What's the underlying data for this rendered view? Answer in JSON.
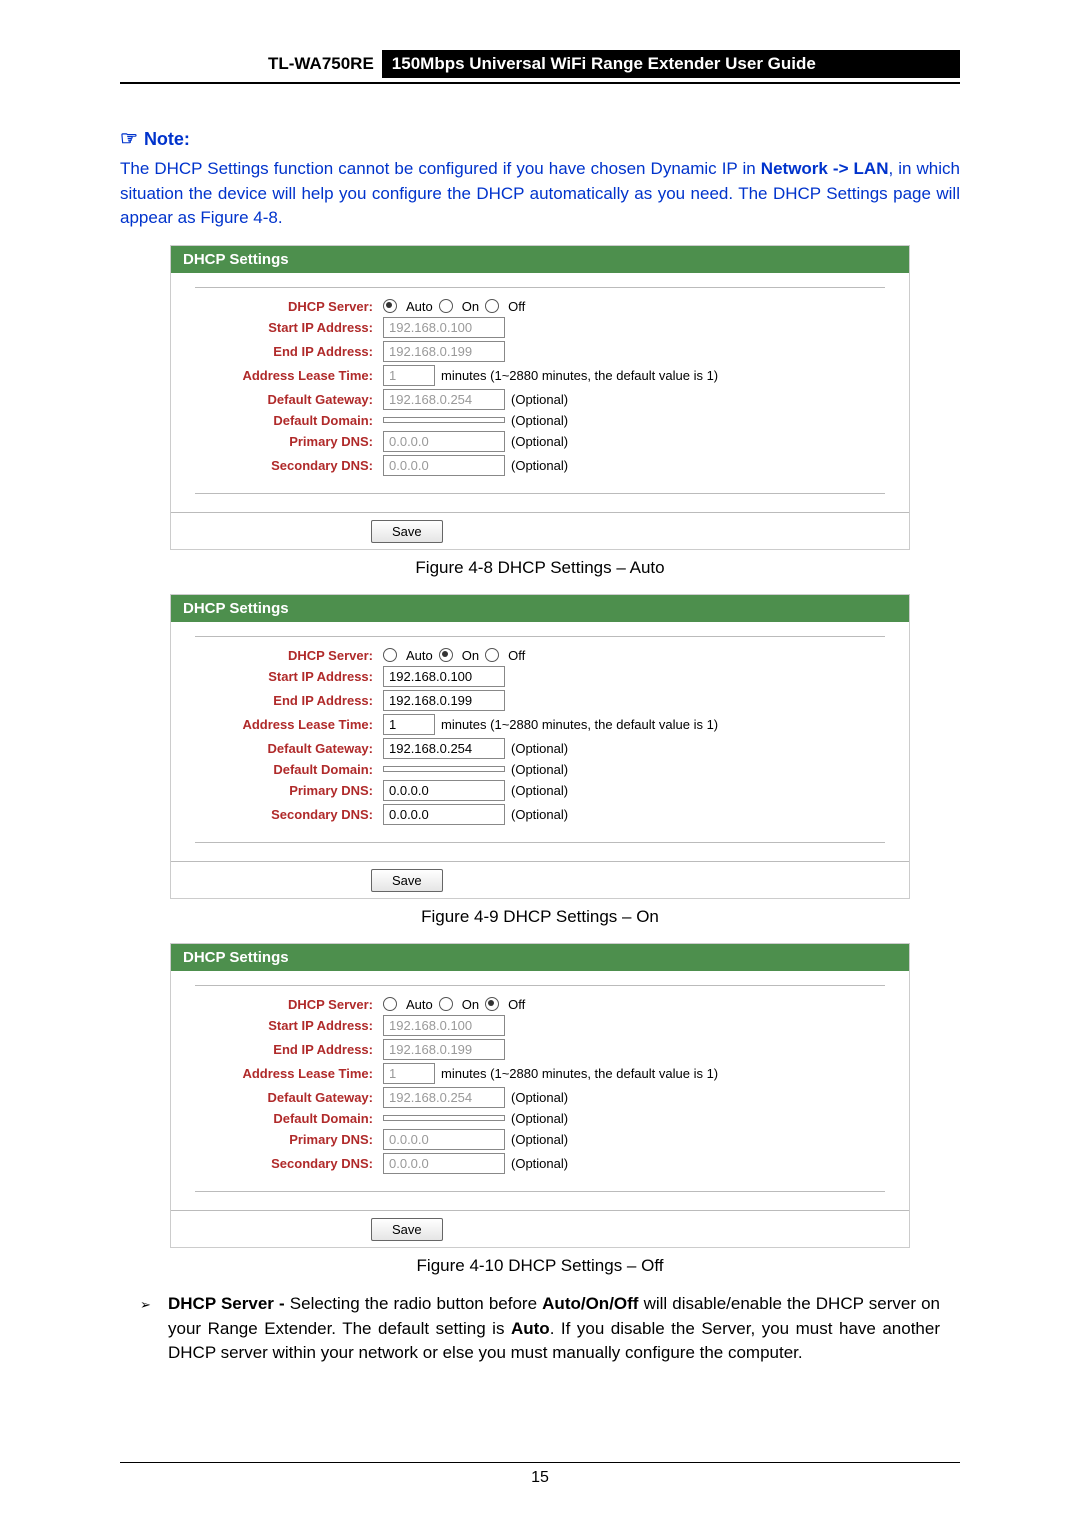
{
  "header": {
    "model": "TL-WA750RE",
    "title": "150Mbps Universal WiFi Range Extender User Guide"
  },
  "note": {
    "heading": "Note:",
    "body_parts": {
      "p1": "The DHCP Settings function cannot be configured if you have chosen Dynamic IP in ",
      "b1": "Network -> LAN",
      "p2": ", in which situation the device will help you configure the DHCP automatically as you need. The DHCP Settings page will appear as Figure 4-8."
    }
  },
  "labels": {
    "panel_title": "DHCP Settings",
    "dhcp_server": "DHCP Server:",
    "start_ip": "Start IP Address:",
    "end_ip": "End IP Address:",
    "lease": "Address Lease Time:",
    "gateway": "Default Gateway:",
    "domain": "Default Domain:",
    "pdns": "Primary DNS:",
    "sdns": "Secondary DNS:",
    "auto": "Auto",
    "on": "On",
    "off": "Off",
    "lease_hint": "minutes (1~2880 minutes, the default value is 1)",
    "optional": "(Optional)",
    "save": "Save"
  },
  "captions": {
    "fig48": "Figure 4-8 DHCP Settings – Auto",
    "fig49": "Figure 4-9 DHCP Settings – On",
    "fig410": "Figure 4-10 DHCP Settings – Off"
  },
  "panels": [
    {
      "selected": "auto",
      "disabled": true,
      "start_ip": "192.168.0.100",
      "end_ip": "192.168.0.199",
      "lease": "1",
      "gateway": "192.168.0.254",
      "domain": "",
      "pdns": "0.0.0.0",
      "sdns": "0.0.0.0"
    },
    {
      "selected": "on",
      "disabled": false,
      "start_ip": "192.168.0.100",
      "end_ip": "192.168.0.199",
      "lease": "1",
      "gateway": "192.168.0.254",
      "domain": "",
      "pdns": "0.0.0.0",
      "sdns": "0.0.0.0"
    },
    {
      "selected": "off",
      "disabled": true,
      "start_ip": "192.168.0.100",
      "end_ip": "192.168.0.199",
      "lease": "1",
      "gateway": "192.168.0.254",
      "domain": "",
      "pdns": "0.0.0.0",
      "sdns": "0.0.0.0"
    }
  ],
  "desc": {
    "bold1": "DHCP Server - ",
    "t1": "Selecting the radio button before ",
    "bold2": "Auto/On/Off",
    "t2": " will disable/enable the DHCP server on your Range Extender. The default setting is ",
    "bold3": "Auto",
    "t3": ". If you disable the Server, you must have another DHCP server within your network or else you must manually configure the computer."
  },
  "page_number": "15"
}
